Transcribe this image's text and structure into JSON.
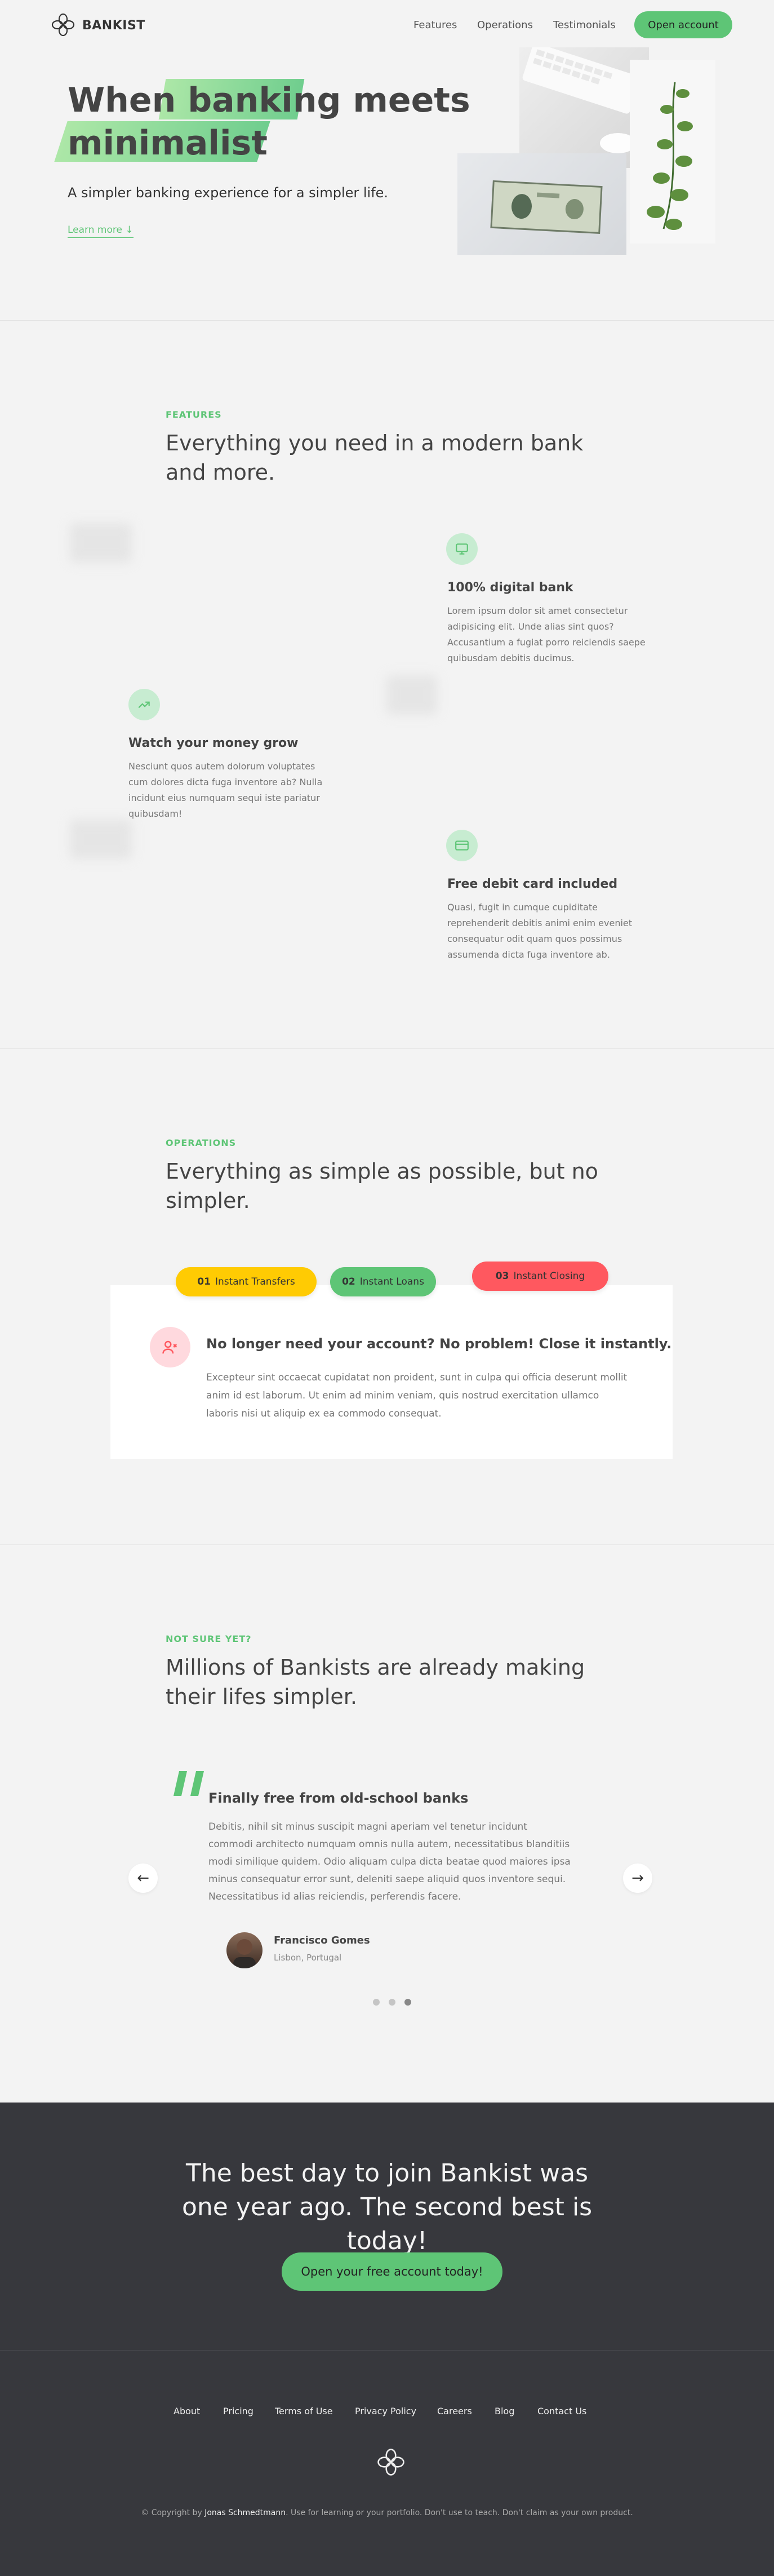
{
  "nav": {
    "brand": "BANKIST",
    "links": [
      "Features",
      "Operations",
      "Testimonials"
    ],
    "cta": "Open account"
  },
  "hero": {
    "title_line1_a": "When",
    "title_line1_b": "banking",
    "title_line1_c": "meets",
    "title_line2": "minimalist",
    "subtitle": "A simpler banking experience for a simpler life.",
    "learn_more": "Learn more ↓"
  },
  "features": {
    "tag": "FEATURES",
    "title": "Everything you need in a modern bank and more.",
    "items": [
      {
        "icon": "monitor-icon",
        "title": "100% digital bank",
        "text": "Lorem ipsum dolor sit amet consectetur adipisicing elit. Unde alias sint quos? Accusantium a fugiat porro reiciendis saepe quibusdam debitis ducimus."
      },
      {
        "icon": "trending-up-icon",
        "title": "Watch your money grow",
        "text": "Nesciunt quos autem dolorum voluptates cum dolores dicta fuga inventore ab? Nulla incidunt eius numquam sequi iste pariatur quibusdam!"
      },
      {
        "icon": "credit-card-icon",
        "title": "Free debit card included",
        "text": "Quasi, fugit in cumque cupiditate reprehenderit debitis animi enim eveniet consequatur odit quam quos possimus assumenda dicta fuga inventore ab."
      }
    ]
  },
  "operations": {
    "tag": "OPERATIONS",
    "title": "Everything as simple as possible, but no simpler.",
    "tabs": [
      {
        "num": "01",
        "label": "Instant Transfers",
        "color": "#ffcb03"
      },
      {
        "num": "02",
        "label": "Instant Loans",
        "color": "#5ec576"
      },
      {
        "num": "03",
        "label": "Instant Closing",
        "color": "#ff585f"
      }
    ],
    "active_title": "No longer need your account? No problem! Close it instantly.",
    "active_text": "Excepteur sint occaecat cupidatat non proident, sunt in culpa qui officia deserunt mollit anim id est laborum. Ut enim ad minim veniam, quis nostrud exercitation ullamco laboris nisi ut aliquip ex ea commodo consequat."
  },
  "testimonials": {
    "tag": "NOT SURE YET?",
    "title": "Millions of Bankists are already making their lifes simpler.",
    "quote_title": "Finally free from old-school banks",
    "quote_text": "Debitis, nihil sit minus suscipit magni aperiam vel tenetur incidunt commodi architecto numquam omnis nulla autem, necessitatibus blanditiis modi similique quidem. Odio aliquam culpa dicta beatae quod maiores ipsa minus consequatur error sunt, deleniti saepe aliquid quos inventore sequi. Necessitatibus id alias reiciendis, perferendis facere.",
    "author": "Francisco Gomes",
    "location": "Lisbon, Portugal",
    "prev": "←",
    "next": "→",
    "active_slide": 3,
    "total_slides": 3
  },
  "signup": {
    "title": "The best day to join Bankist was one year ago. The second best is today!",
    "cta": "Open your free account today!"
  },
  "footer": {
    "links": [
      "About",
      "Pricing",
      "Terms of Use",
      "Privacy Policy",
      "Careers",
      "Blog",
      "Contact Us"
    ],
    "copy_prefix": "© Copyright by",
    "copy_name": "Jonas Schmedtmann",
    "copy_suffix": ". Use for learning or your portfolio. Don't use to teach. Don't claim as your own product."
  },
  "colors": {
    "accent": "#5ec576",
    "yellow": "#ffcb03",
    "red": "#ff585f",
    "dark": "#37383d"
  }
}
